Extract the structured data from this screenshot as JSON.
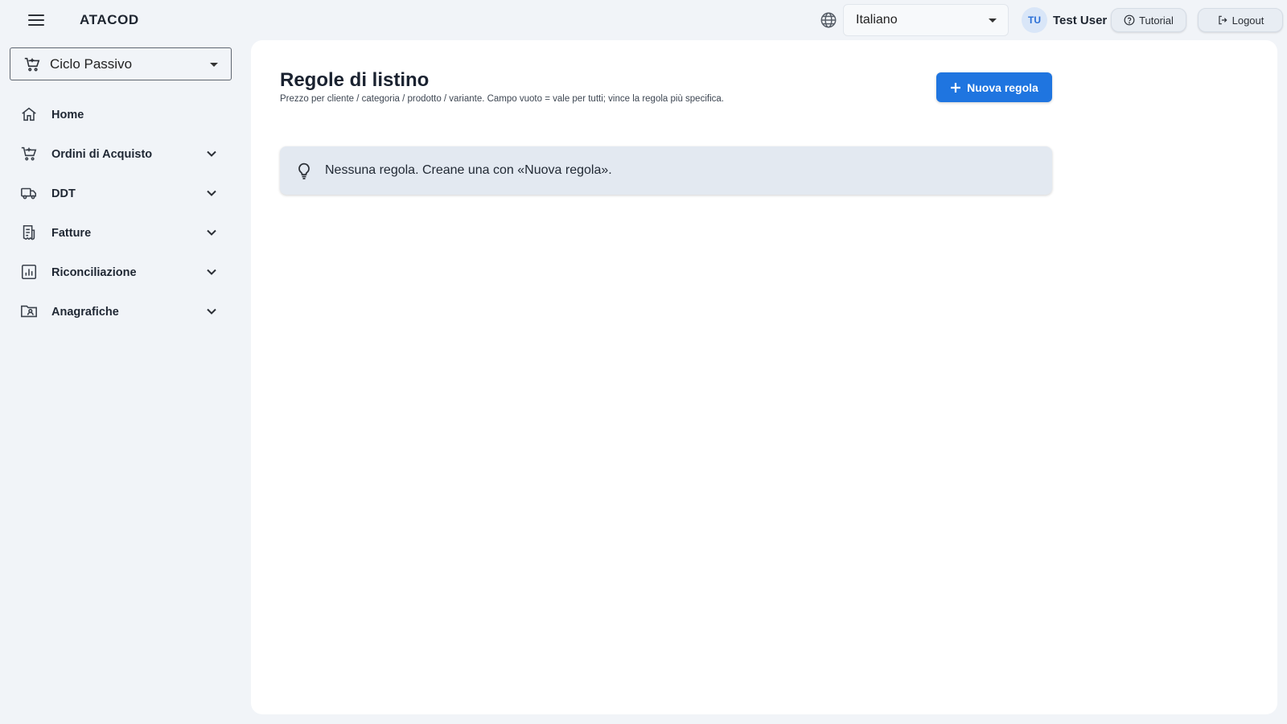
{
  "header": {
    "brand": "ATACOD",
    "language": {
      "selected": "Italiano"
    },
    "user": {
      "initials": "TU",
      "name": "Test User"
    },
    "tutorial_label": "Tutorial",
    "logout_label": "Logout"
  },
  "sidebar": {
    "module_select": "Ciclo Passivo",
    "items": [
      {
        "label": "Home",
        "icon": "home-icon",
        "expandable": false
      },
      {
        "label": "Ordini di Acquisto",
        "icon": "cart-icon",
        "expandable": true
      },
      {
        "label": "DDT",
        "icon": "truck-icon",
        "expandable": true
      },
      {
        "label": "Fatture",
        "icon": "receipt-icon",
        "expandable": true
      },
      {
        "label": "Riconciliazione",
        "icon": "chart-icon",
        "expandable": true
      },
      {
        "label": "Anagrafiche",
        "icon": "contact-folder-icon",
        "expandable": true
      }
    ]
  },
  "main": {
    "title": "Regole di listino",
    "subtitle": "Prezzo per cliente / categoria / prodotto / variante. Campo vuoto = vale per tutti; vince la regola più specifica.",
    "new_rule_label": "Nuova regola",
    "empty_message": "Nessuna regola. Creane una con «Nuova regola»."
  },
  "colors": {
    "background": "#f1f4f8",
    "accent": "#1f75e0",
    "alert_bg": "#e3e9f1"
  }
}
